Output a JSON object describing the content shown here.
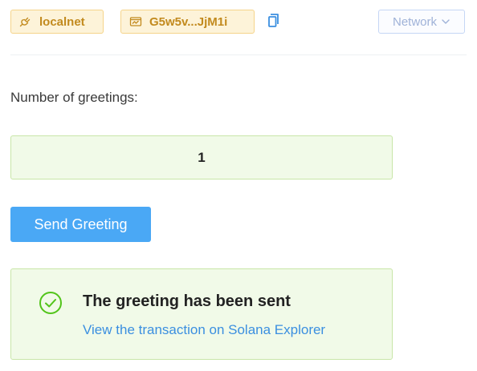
{
  "header": {
    "network_tag": {
      "label": "localnet",
      "icon": "plug-icon"
    },
    "address_tag": {
      "label": "G5w5v...JjM1i",
      "icon": "wallet-icon"
    },
    "copy_icon": "copy-icon",
    "network_select": {
      "label": "Network",
      "icon": "chevron-down-icon"
    }
  },
  "main": {
    "greetings_label": "Number of greetings:",
    "greetings_count": "1",
    "send_button_label": "Send Greeting"
  },
  "alert": {
    "icon": "check-circle-icon",
    "title": "The greeting has been sent",
    "link_text": "View the transaction on Solana Explorer"
  },
  "colors": {
    "tag_bg": "#fdf3d9",
    "tag_border": "#f5d48a",
    "tag_text": "#c28a1e",
    "success_bg": "#f1fae8",
    "success_border": "#c8e6a8",
    "success_icon": "#52c41a",
    "primary_button": "#4aa8f5",
    "link": "#3b8fe0",
    "select_border": "#c5d6f5",
    "select_text": "#9fb2d8"
  }
}
